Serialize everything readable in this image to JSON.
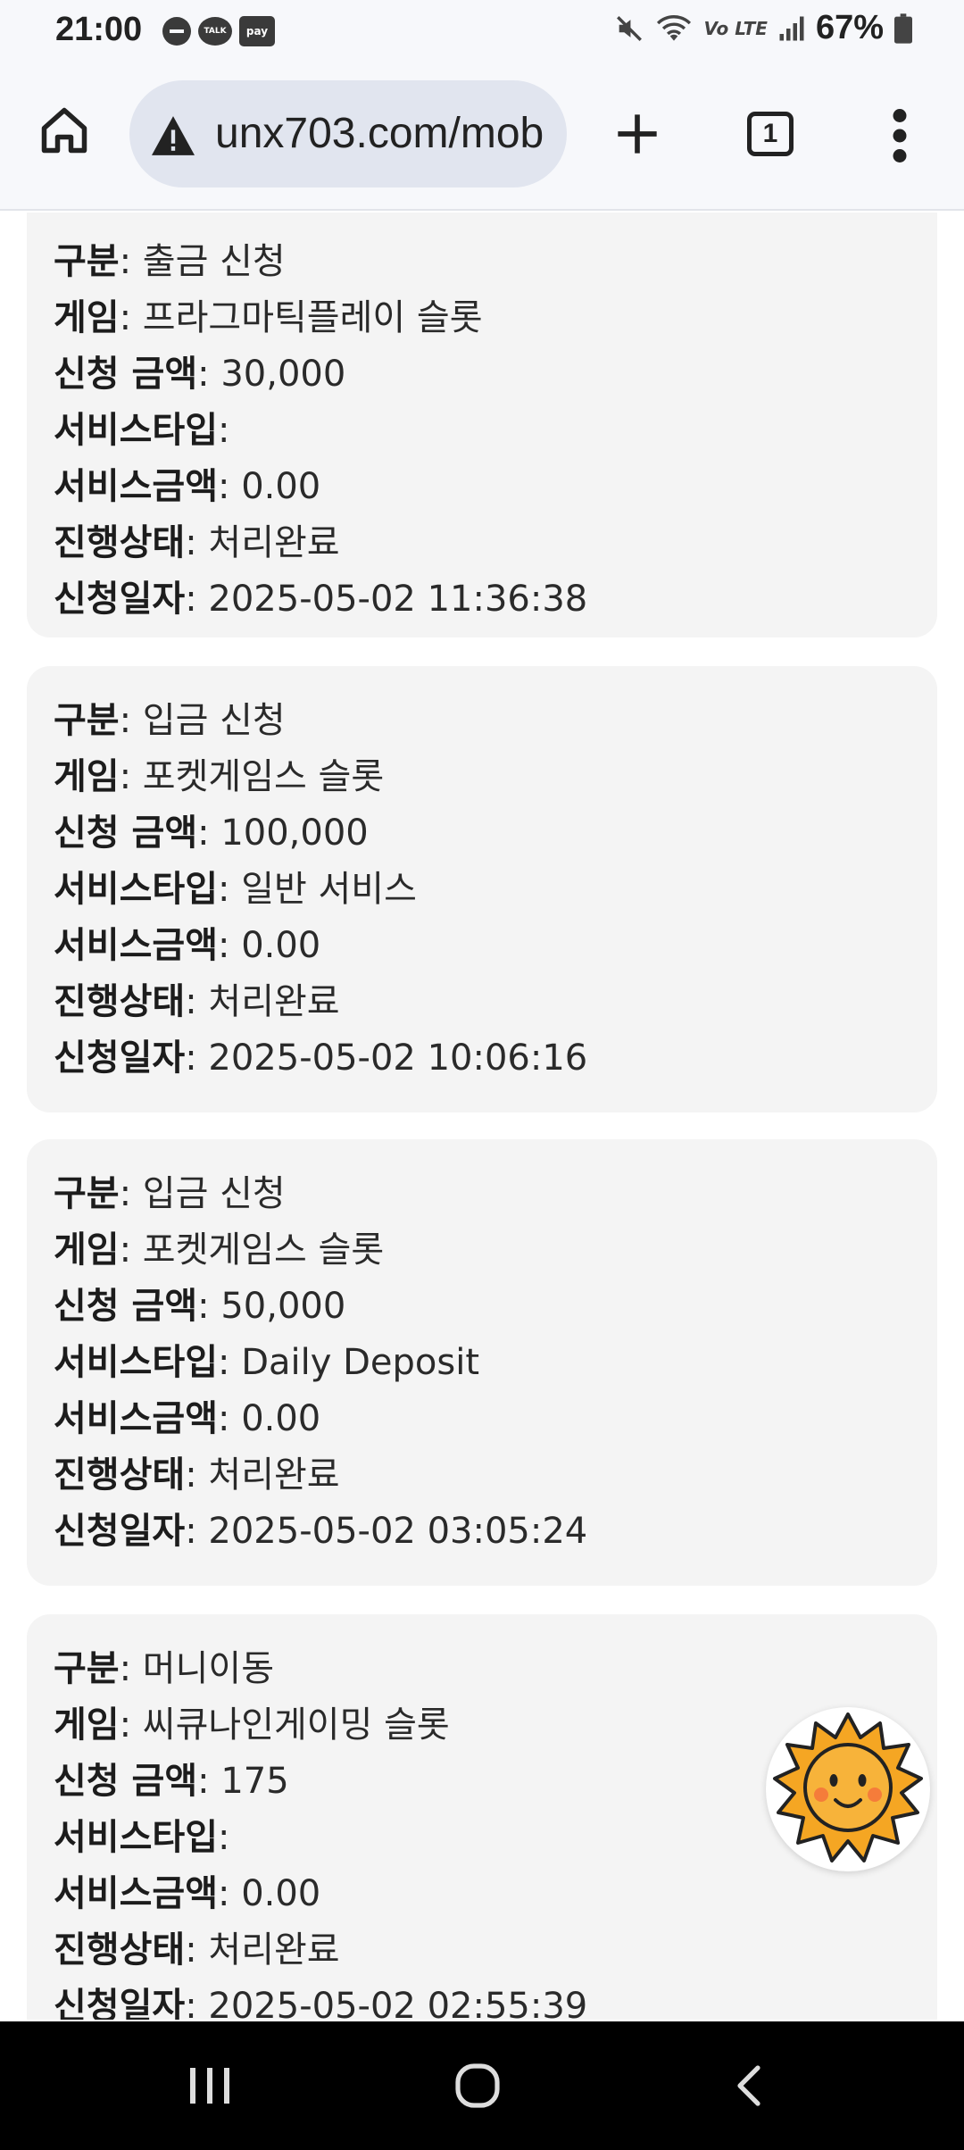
{
  "status_bar": {
    "time": "21:00",
    "talk_label": "TALK",
    "pay_label": "pay",
    "network": "Vo LTE",
    "battery": "67%"
  },
  "browser": {
    "url": "unx703.com/mob",
    "tab_count": "1"
  },
  "records": [
    {
      "fields": [
        {
          "label": "구분",
          "value": ": 출금 신청"
        },
        {
          "label": "게임",
          "value": ": 프라그마틱플레이 슬롯"
        },
        {
          "label": "신청 금액",
          "value": ": 30,000"
        },
        {
          "label": "서비스타입",
          "value": ":"
        },
        {
          "label": "서비스금액",
          "value": ": 0.00"
        },
        {
          "label": "진행상태",
          "value": ": 처리완료"
        },
        {
          "label": "신청일자",
          "value": ": 2025-05-02 11:36:38"
        }
      ]
    },
    {
      "fields": [
        {
          "label": "구분",
          "value": ": 입금 신청"
        },
        {
          "label": "게임",
          "value": ": 포켓게임스 슬롯"
        },
        {
          "label": "신청 금액",
          "value": ": 100,000"
        },
        {
          "label": "서비스타입",
          "value": ": 일반 서비스"
        },
        {
          "label": "서비스금액",
          "value": ": 0.00"
        },
        {
          "label": "진행상태",
          "value": ": 처리완료"
        },
        {
          "label": "신청일자",
          "value": ": 2025-05-02 10:06:16"
        }
      ]
    },
    {
      "fields": [
        {
          "label": "구분",
          "value": ": 입금 신청"
        },
        {
          "label": "게임",
          "value": ": 포켓게임스 슬롯"
        },
        {
          "label": "신청 금액",
          "value": ": 50,000"
        },
        {
          "label": "서비스타입",
          "value": ": Daily Deposit"
        },
        {
          "label": "서비스금액",
          "value": ": 0.00"
        },
        {
          "label": "진행상태",
          "value": ": 처리완료"
        },
        {
          "label": "신청일자",
          "value": ": 2025-05-02 03:05:24"
        }
      ]
    },
    {
      "fields": [
        {
          "label": "구분",
          "value": ": 머니이동"
        },
        {
          "label": "게임",
          "value": ": 씨큐나인게이밍 슬롯"
        },
        {
          "label": "신청 금액",
          "value": ": 175"
        },
        {
          "label": "서비스타입",
          "value": ":"
        },
        {
          "label": "서비스금액",
          "value": ": 0.00"
        },
        {
          "label": "진행상태",
          "value": ": 처리완료"
        },
        {
          "label": "신청일자",
          "value": ": 2025-05-02 02:55:39"
        }
      ]
    }
  ],
  "icons": {
    "home": "home-icon",
    "warning": "warning-icon",
    "add_tab": "plus-icon",
    "tabs": "tab-switcher-icon",
    "menu": "more-vert-icon",
    "floating": "sun-face-icon",
    "nav_recents": "recents-icon",
    "nav_home": "nav-home-icon",
    "nav_back": "back-icon"
  },
  "colors": {
    "card_bg": "#f4f4f4",
    "toolbar_bg": "#f7f8fb",
    "urlbar_bg": "#e1e5ef",
    "sun": "#f5a623"
  }
}
